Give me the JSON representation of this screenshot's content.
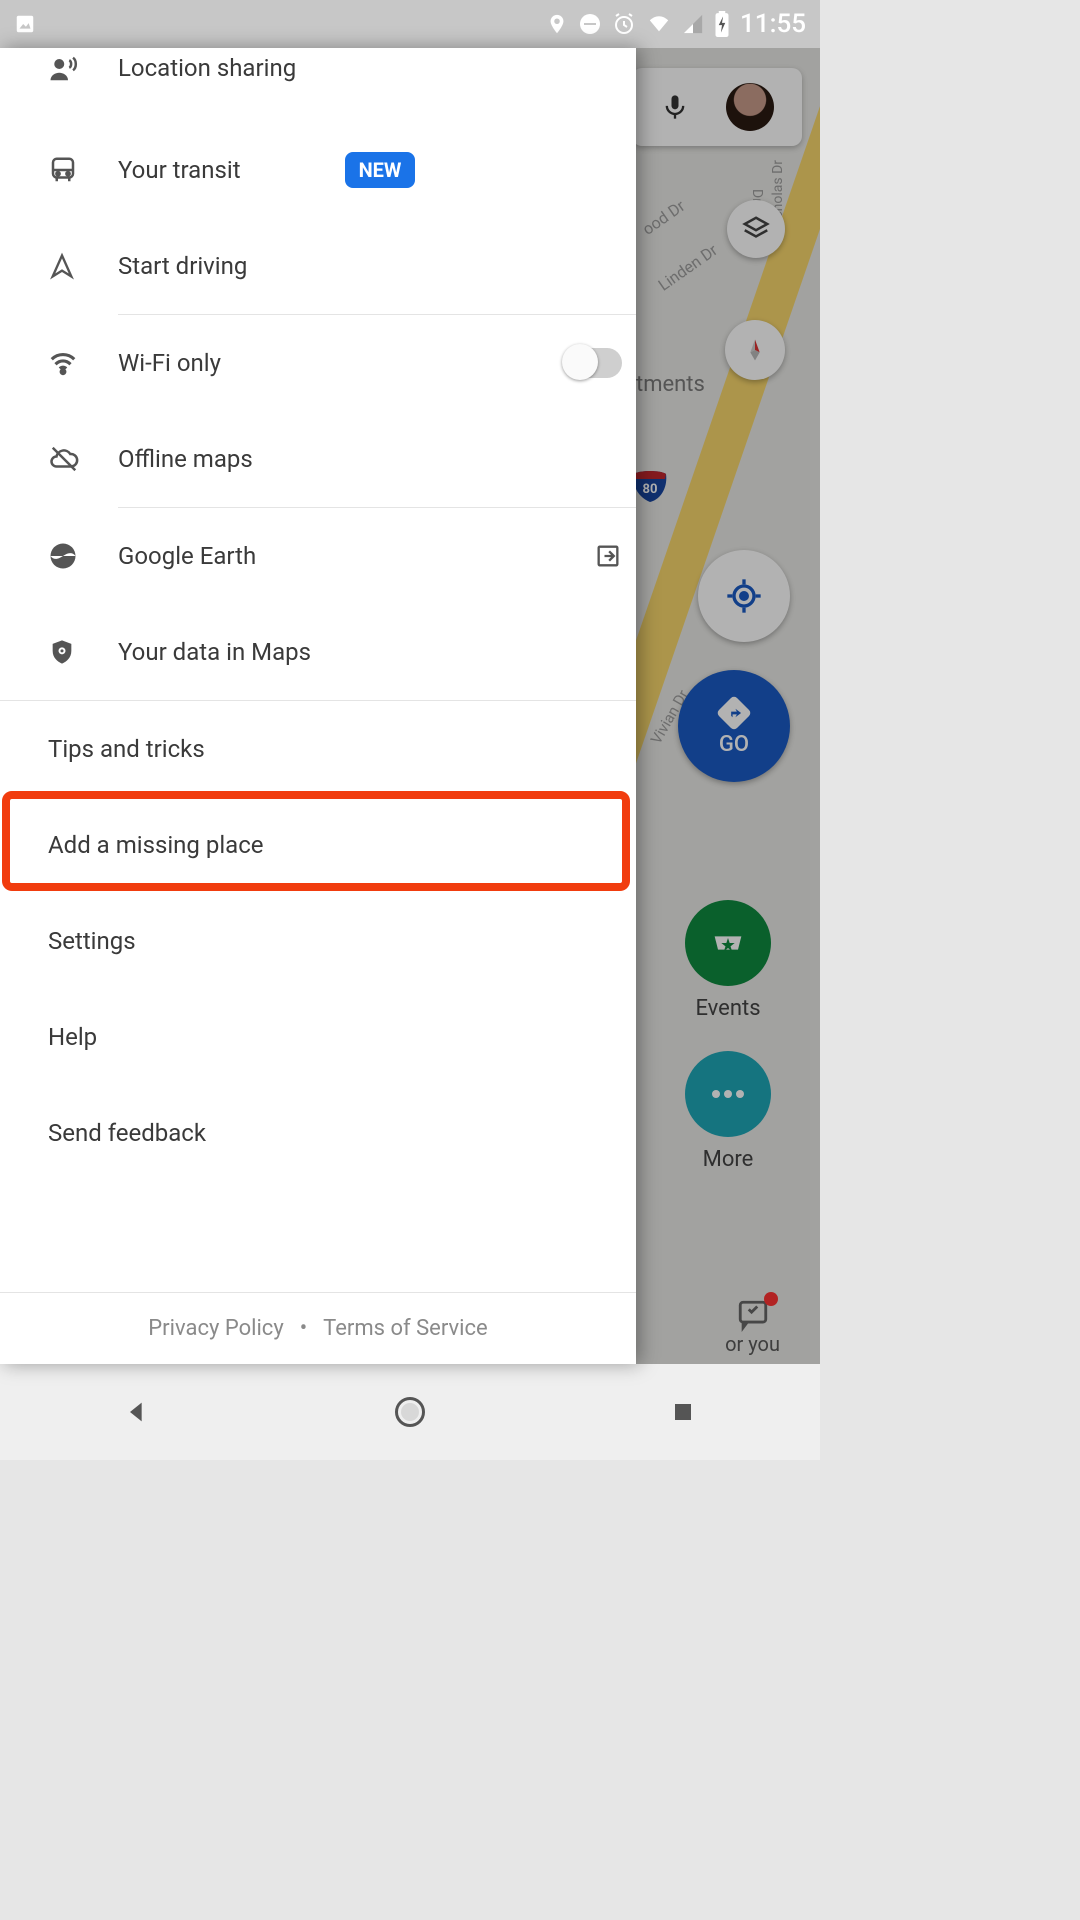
{
  "statusbar": {
    "time": "11:55"
  },
  "drawer": {
    "location_sharing": "Location sharing",
    "your_transit": "Your transit",
    "new_badge": "NEW",
    "start_driving": "Start driving",
    "wifi_only": "Wi-Fi only",
    "offline_maps": "Offline maps",
    "google_earth": "Google Earth",
    "your_data": "Your data in Maps",
    "tips": "Tips and tricks",
    "add_missing": "Add a missing place",
    "settings": "Settings",
    "help": "Help",
    "send_feedback": "Send feedback",
    "footer": {
      "privacy": "Privacy Policy",
      "terms": "Terms of Service"
    }
  },
  "map": {
    "go_label": "GO",
    "chips": {
      "events": "Events",
      "more": "More"
    },
    "labels": {
      "tments": "tments",
      "ood": "ood Dr",
      "linden": "Linden Dr",
      "dr": "Dr",
      "nicholas": "Nicholas Dr",
      "vivian": "Vivian Dr",
      "shield": "80"
    },
    "foryou": "or you"
  }
}
